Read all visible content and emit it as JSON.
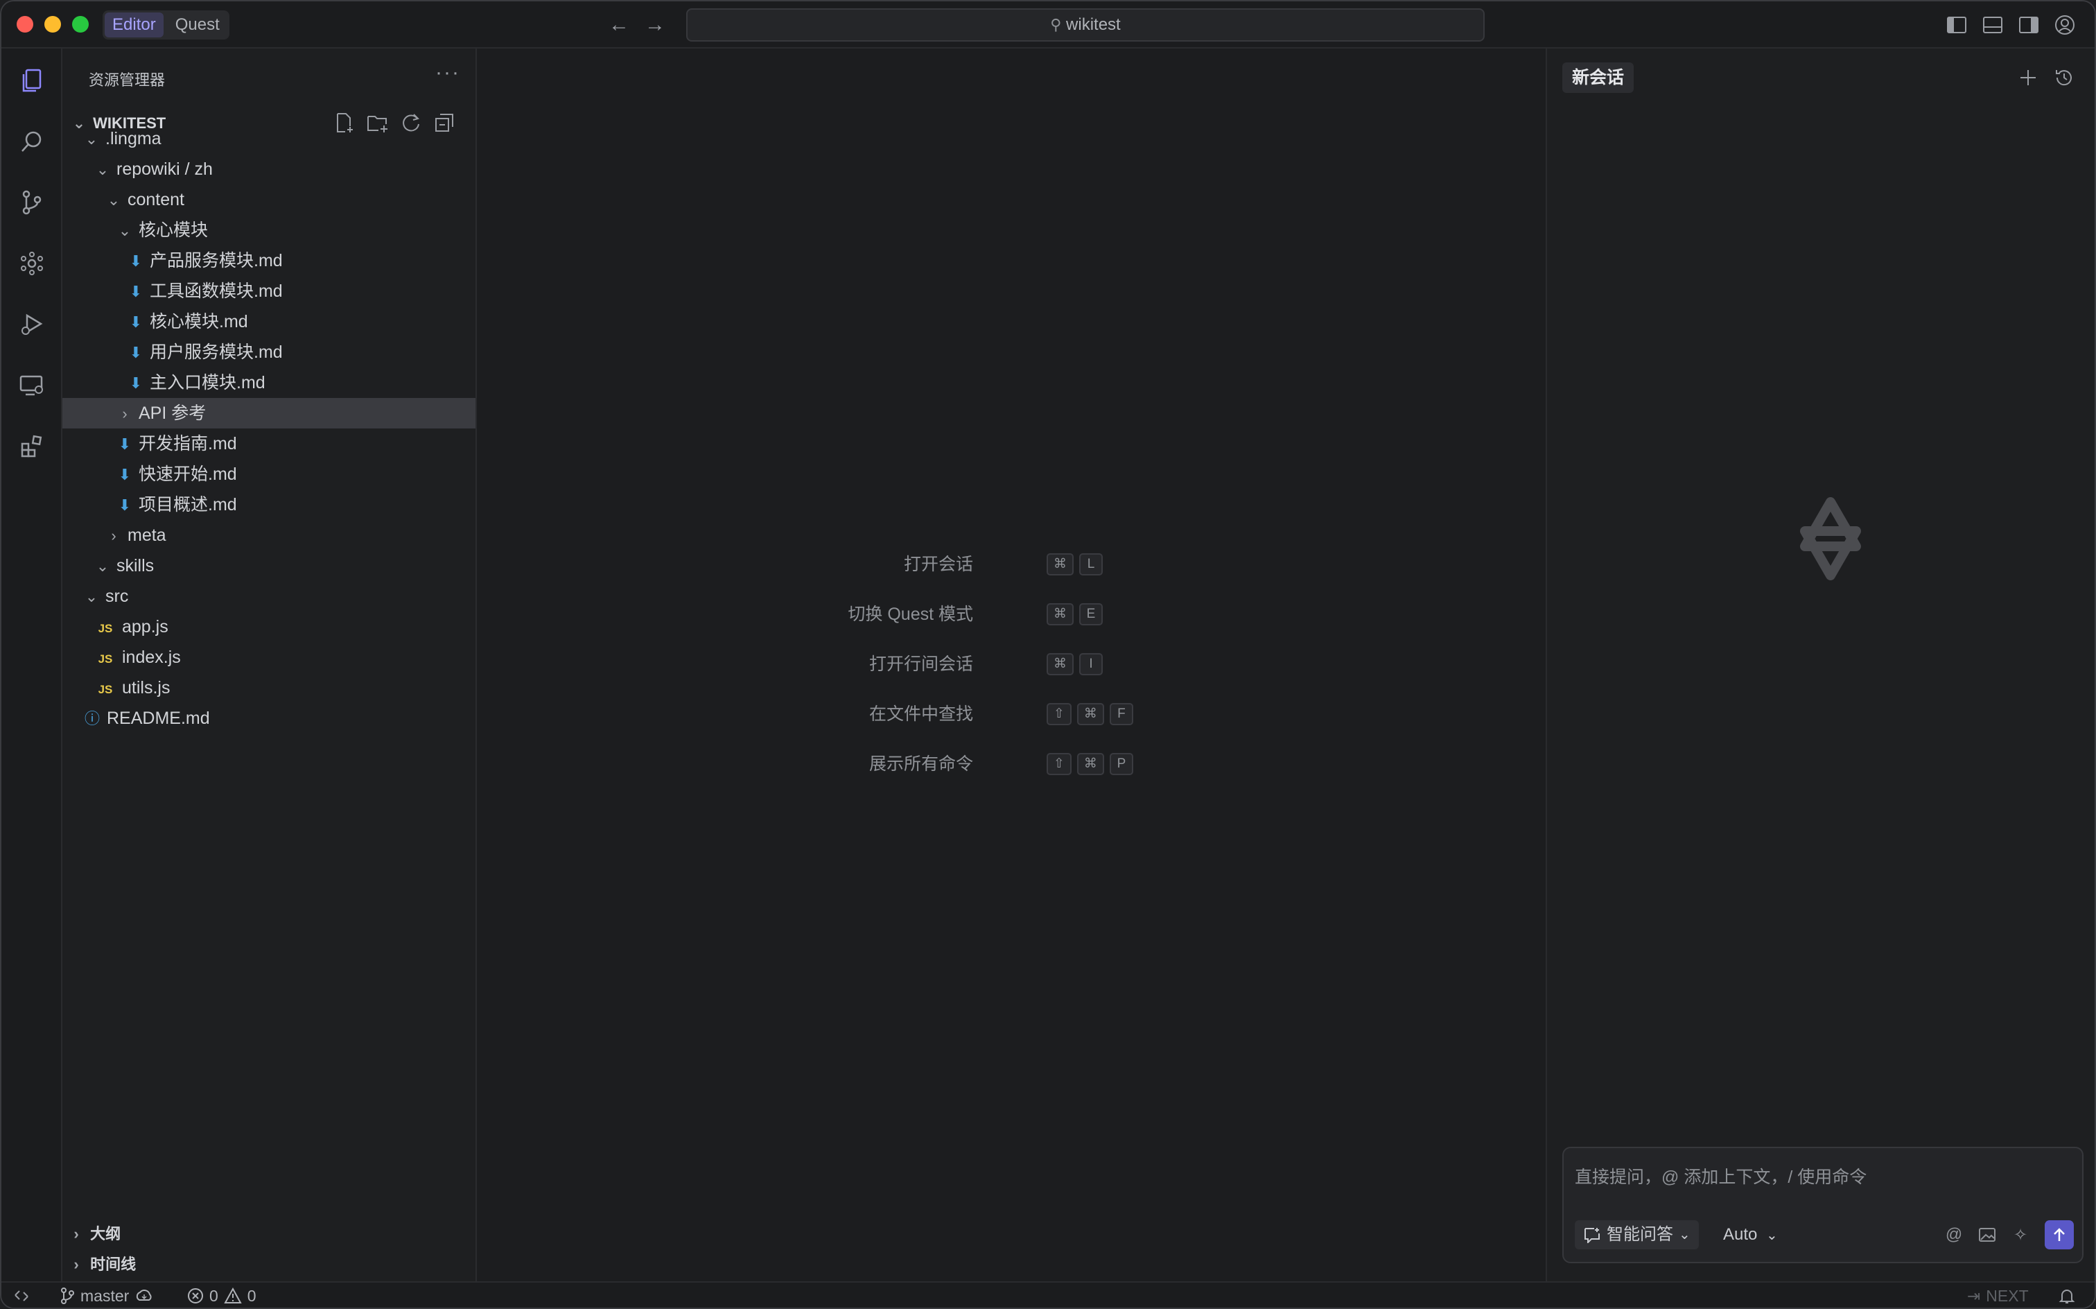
{
  "titlebar": {
    "tabs": [
      {
        "label": "Editor",
        "active": true
      },
      {
        "label": "Quest",
        "active": false
      }
    ],
    "search": "wikitest",
    "back_icon": "arrow-left",
    "forward_icon": "arrow-right"
  },
  "colors": {
    "accent": "#5a58c8",
    "md_icon": "#4aa3df",
    "js_icon": "#e7c84a"
  },
  "activity_bar": [
    "explorer",
    "search",
    "source-control",
    "extensions-graph",
    "run-debug",
    "remote",
    "extensions"
  ],
  "sidebar": {
    "title": "资源管理器",
    "more": "···",
    "root": "WIKITEST",
    "tree": [
      {
        "label": ".lingma",
        "kind": "folder-open",
        "depth": 1
      },
      {
        "label": "repowiki / zh",
        "kind": "folder-open",
        "depth": 2
      },
      {
        "label": "content",
        "kind": "folder-open",
        "depth": 3
      },
      {
        "label": "核心模块",
        "kind": "folder-open",
        "depth": 4
      },
      {
        "label": "产品服务模块.md",
        "kind": "md",
        "depth": 5
      },
      {
        "label": "工具函数模块.md",
        "kind": "md",
        "depth": 5
      },
      {
        "label": "核心模块.md",
        "kind": "md",
        "depth": 5
      },
      {
        "label": "用户服务模块.md",
        "kind": "md",
        "depth": 5
      },
      {
        "label": "主入口模块.md",
        "kind": "md",
        "depth": 5
      },
      {
        "label": "API 参考",
        "kind": "folder-closed",
        "depth": 4,
        "selected": true
      },
      {
        "label": "开发指南.md",
        "kind": "md",
        "depth": 4
      },
      {
        "label": "快速开始.md",
        "kind": "md",
        "depth": 4
      },
      {
        "label": "项目概述.md",
        "kind": "md",
        "depth": 4
      },
      {
        "label": "meta",
        "kind": "folder-closed",
        "depth": 3
      },
      {
        "label": "skills",
        "kind": "folder-open",
        "depth": 2
      },
      {
        "label": "src",
        "kind": "folder-open",
        "depth": 1
      },
      {
        "label": "app.js",
        "kind": "js",
        "depth": 2
      },
      {
        "label": "index.js",
        "kind": "js",
        "depth": 2
      },
      {
        "label": "utils.js",
        "kind": "js",
        "depth": 2
      },
      {
        "label": "README.md",
        "kind": "info",
        "depth": 1
      }
    ],
    "js_badge": "JS",
    "bottom_sections": [
      "大纲",
      "时间线"
    ]
  },
  "editor": {
    "hints": [
      {
        "label": "打开会话",
        "keys": [
          "⌘",
          "L"
        ]
      },
      {
        "label": "切换 Quest 模式",
        "keys": [
          "⌘",
          "E"
        ]
      },
      {
        "label": "打开行间会话",
        "keys": [
          "⌘",
          "I"
        ]
      },
      {
        "label": "在文件中查找",
        "keys": [
          "⇧",
          "⌘",
          "F"
        ]
      },
      {
        "label": "展示所有命令",
        "keys": [
          "⇧",
          "⌘",
          "P"
        ]
      }
    ]
  },
  "panel": {
    "new_chat": "新会话",
    "placeholder": "直接提问，@ 添加上下文，/ 使用命令",
    "mode": "智能问答",
    "model": "Auto"
  },
  "status": {
    "branch": "master",
    "errors": "0",
    "warnings": "0",
    "next": "NEXT"
  }
}
